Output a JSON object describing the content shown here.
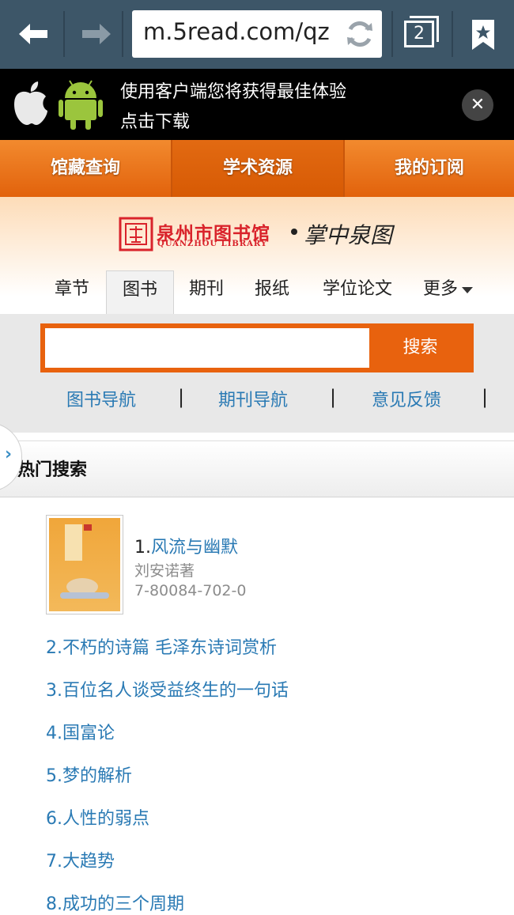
{
  "browser": {
    "url": "m.5read.com/qz",
    "tab_count": "2"
  },
  "banner": {
    "line1": "使用客户端您将获得最佳体验",
    "line2": "点击下载"
  },
  "main_nav": [
    {
      "label": "馆藏查询"
    },
    {
      "label": "学术资源"
    },
    {
      "label": "我的订阅"
    }
  ],
  "logo": {
    "cn": "泉州市图书馆",
    "en": "QUANZHOU LIBRARY",
    "slogan": "掌中泉图"
  },
  "categories": [
    {
      "label": "章节"
    },
    {
      "label": "图书"
    },
    {
      "label": "期刊"
    },
    {
      "label": "报纸"
    },
    {
      "label": "学位论文"
    },
    {
      "label": "更多"
    }
  ],
  "search": {
    "placeholder": "",
    "button": "搜索"
  },
  "sub_links": [
    {
      "label": "图书导航"
    },
    {
      "label": "期刊导航"
    },
    {
      "label": "意见反馈"
    }
  ],
  "pipe": "|",
  "hot_search": {
    "title": "热门搜索",
    "first": {
      "num": "1.",
      "title": "风流与幽默",
      "author": "刘安诺著",
      "isbn": "7-80084-702-0"
    },
    "items": [
      "2.不朽的诗篇 毛泽东诗词赏析",
      "3.百位名人谈受益终生的一句话",
      "4.国富论",
      "5.梦的解析",
      "6.人性的弱点",
      "7.大趋势",
      "8.成功的三个周期"
    ]
  },
  "colors": {
    "accent": "#e8620e",
    "link": "#2a7ab4",
    "toolbar": "#3d5668"
  }
}
